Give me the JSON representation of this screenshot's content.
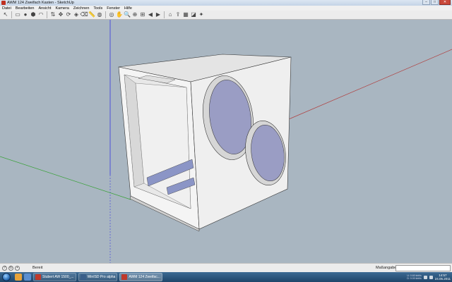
{
  "window": {
    "title": "AWM 124 Zweifach Kasten - SketchUp"
  },
  "menu": [
    "Datei",
    "Bearbeiten",
    "Ansicht",
    "Kamera",
    "Zeichnen",
    "Tools",
    "Fenster",
    "Hilfe"
  ],
  "toolbar": {
    "tools": [
      {
        "name": "select-tool-icon",
        "glyph": "↖"
      },
      {
        "name": "rectangle-tool-icon",
        "glyph": "▭"
      },
      {
        "name": "circle-tool-icon",
        "glyph": "●"
      },
      {
        "name": "polygon-tool-icon",
        "glyph": "⬢"
      },
      {
        "name": "arc-tool-icon",
        "glyph": "◠"
      },
      {
        "name": "pushpull-tool-icon",
        "glyph": "⇅"
      },
      {
        "name": "move-tool-icon",
        "glyph": "✥"
      },
      {
        "name": "rotate-tool-icon",
        "glyph": "⟳"
      },
      {
        "name": "offset-tool-icon",
        "glyph": "◈"
      },
      {
        "name": "eraser-tool-icon",
        "glyph": "⌫"
      },
      {
        "name": "tape-measure-tool-icon",
        "glyph": "📏"
      },
      {
        "name": "paint-bucket-tool-icon",
        "glyph": "◍"
      },
      {
        "name": "orbit-tool-icon",
        "glyph": "◎"
      },
      {
        "name": "pan-tool-icon",
        "glyph": "✋"
      },
      {
        "name": "zoom-tool-icon",
        "glyph": "🔍"
      },
      {
        "name": "zoom-window-tool-icon",
        "glyph": "⊕"
      },
      {
        "name": "zoom-extents-tool-icon",
        "glyph": "⊞"
      },
      {
        "name": "previous-view-icon",
        "glyph": "◀"
      },
      {
        "name": "next-view-icon",
        "glyph": "▶"
      },
      {
        "name": "get-models-icon",
        "glyph": "⌂"
      },
      {
        "name": "share-model-icon",
        "glyph": "⇪"
      },
      {
        "name": "components-icon",
        "glyph": "▦"
      },
      {
        "name": "styles-icon",
        "glyph": "◪"
      },
      {
        "name": "extensions-icon",
        "glyph": "✦"
      }
    ]
  },
  "status": {
    "text": "Bereit",
    "measurements_label": "Maßangaben",
    "measurements_value": ""
  },
  "taskbar": {
    "tasks": [
      {
        "label": "Stubert AW 1500_...",
        "color": "#c0392b",
        "active": false
      },
      {
        "label": "WinISD Pro alpha",
        "color": "#3a5f8a",
        "active": false
      },
      {
        "label": "AWM 124 Zweifac...",
        "color": "#c0392b",
        "active": true
      }
    ],
    "net_up": "U: 0.60 kbit/s",
    "net_down": "D: 0.00 kbit/s",
    "time": "14:57",
    "date": "24.05.2011"
  },
  "colors": {
    "viewport_bg": "#a9b6c1",
    "box_face": "#f2f2f2",
    "speaker_cone": "#9a9dc4"
  }
}
